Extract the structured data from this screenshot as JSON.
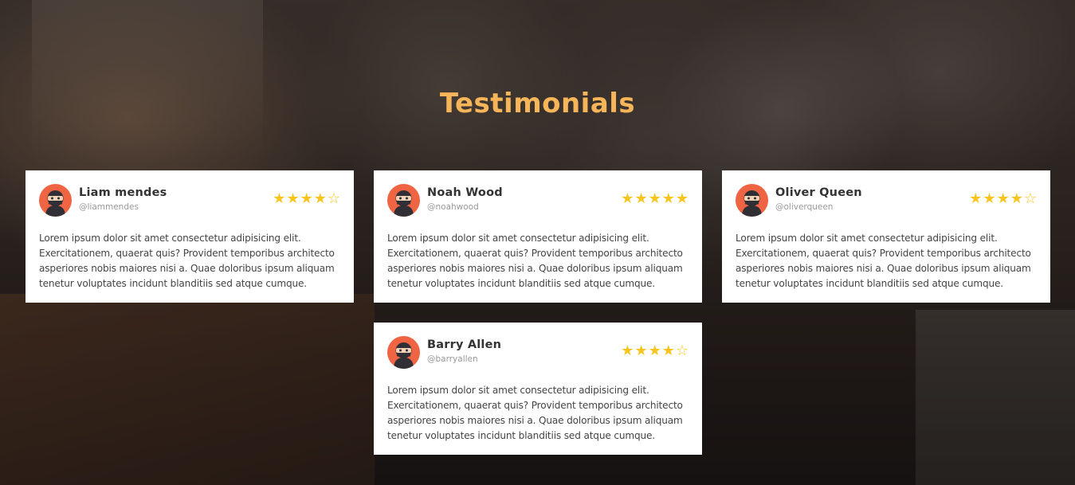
{
  "section": {
    "title": "Testimonials"
  },
  "colors": {
    "accent": "#f7b55a",
    "star": "#f7c51e",
    "avatar_bg": "#ef6443"
  },
  "testimonials": [
    {
      "name": "Liam mendes",
      "handle": "@liammendes",
      "rating": 4,
      "max_rating": 5,
      "text": "Lorem ipsum dolor sit amet consectetur adipisicing elit. Exercitationem, quaerat quis? Provident temporibus architecto asperiores nobis maiores nisi a. Quae doloribus ipsum aliquam tenetur voluptates incidunt blanditiis sed atque cumque."
    },
    {
      "name": "Noah Wood",
      "handle": "@noahwood",
      "rating": 5,
      "max_rating": 5,
      "text": "Lorem ipsum dolor sit amet consectetur adipisicing elit. Exercitationem, quaerat quis? Provident temporibus architecto asperiores nobis maiores nisi a. Quae doloribus ipsum aliquam tenetur voluptates incidunt blanditiis sed atque cumque."
    },
    {
      "name": "Oliver Queen",
      "handle": "@oliverqueen",
      "rating": 4,
      "max_rating": 5,
      "text": "Lorem ipsum dolor sit amet consectetur adipisicing elit. Exercitationem, quaerat quis? Provident temporibus architecto asperiores nobis maiores nisi a. Quae doloribus ipsum aliquam tenetur voluptates incidunt blanditiis sed atque cumque."
    },
    {
      "name": "Barry Allen",
      "handle": "@barryallen",
      "rating": 4,
      "max_rating": 5,
      "text": "Lorem ipsum dolor sit amet consectetur adipisicing elit. Exercitationem, quaerat quis? Provident temporibus architecto asperiores nobis maiores nisi a. Quae doloribus ipsum aliquam tenetur voluptates incidunt blanditiis sed atque cumque."
    }
  ]
}
